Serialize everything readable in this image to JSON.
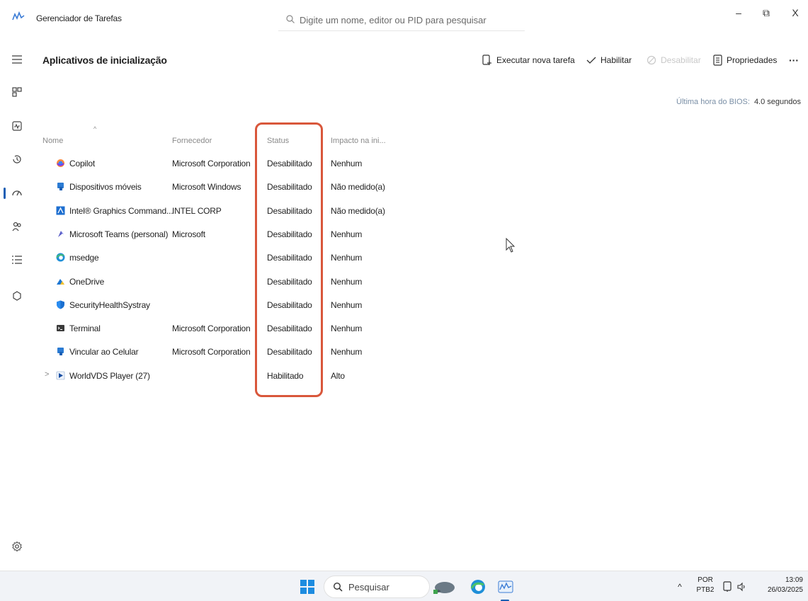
{
  "window": {
    "title": "Gerenciador de Tarefas",
    "search_placeholder": "Digite um nome, editor ou PID para pesquisar",
    "minimize": "–",
    "restore": "⧉",
    "close": "X"
  },
  "header": {
    "title": "Aplicativos de inicialização",
    "actions": {
      "new_task": "Executar nova tarefa",
      "enable": "Habilitar",
      "disable": "Desabilitar",
      "properties": "Propriedades",
      "more": "···"
    },
    "bios_label": "Última hora do BIOS:",
    "bios_value": "4.0 segundos"
  },
  "table": {
    "columns": {
      "name": "Nome",
      "publisher": "Fornecedor",
      "status": "Status",
      "impact": "Impacto na ini..."
    },
    "rows": [
      {
        "name": "Copilot",
        "publisher": "Microsoft Corporation",
        "status": "Desabilitado",
        "impact": "Nenhum",
        "icon": "copilot-icon"
      },
      {
        "name": "Dispositivos móveis",
        "publisher": "Microsoft Windows",
        "status": "Desabilitado",
        "impact": "Não medido(a)",
        "icon": "phone-link-icon"
      },
      {
        "name": "Intel® Graphics Command...",
        "publisher": "INTEL CORP",
        "status": "Desabilitado",
        "impact": "Não medido(a)",
        "icon": "intel-graphics-icon"
      },
      {
        "name": "Microsoft Teams (personal)",
        "publisher": "Microsoft",
        "status": "Desabilitado",
        "impact": "Nenhum",
        "icon": "teams-icon"
      },
      {
        "name": "msedge",
        "publisher": "",
        "status": "Desabilitado",
        "impact": "Nenhum",
        "icon": "edge-icon"
      },
      {
        "name": "OneDrive",
        "publisher": "",
        "status": "Desabilitado",
        "impact": "Nenhum",
        "icon": "onedrive-icon"
      },
      {
        "name": "SecurityHealthSystray",
        "publisher": "",
        "status": "Desabilitado",
        "impact": "Nenhum",
        "icon": "security-shield-icon"
      },
      {
        "name": "Terminal",
        "publisher": "Microsoft Corporation",
        "status": "Desabilitado",
        "impact": "Nenhum",
        "icon": "terminal-icon"
      },
      {
        "name": "Vincular ao Celular",
        "publisher": "Microsoft Corporation",
        "status": "Desabilitado",
        "impact": "Nenhum",
        "icon": "phone-link-icon"
      },
      {
        "name": "WorldVDS Player (27)",
        "publisher": "",
        "status": "Habilitado",
        "impact": "Alto",
        "icon": "play-icon"
      }
    ]
  },
  "taskbar": {
    "search_label": "Pesquisar",
    "lang_top": "POR",
    "lang_bottom": "PTB2",
    "time": "13:09",
    "date": "26/03/2025"
  },
  "colors": {
    "highlight": "#d9573b",
    "accent": "#1a5fb4"
  }
}
